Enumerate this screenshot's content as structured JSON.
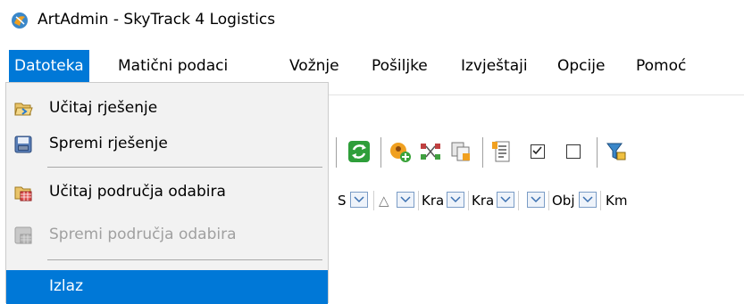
{
  "window": {
    "title": "ArtAdmin - SkyTrack 4 Logistics",
    "app_icon": "artadmin-icon"
  },
  "menubar": {
    "items": [
      {
        "label": "Datoteka",
        "open": true
      },
      {
        "label": "Matični podaci"
      },
      {
        "label": "Vožnje"
      },
      {
        "label": "Pošiljke"
      },
      {
        "label": "Izvještaji"
      },
      {
        "label": "Opcije"
      },
      {
        "label": "Pomoć"
      }
    ]
  },
  "file_menu": {
    "items": [
      {
        "label": "Učitaj rješenje",
        "icon": "folder-open-icon",
        "enabled": true
      },
      {
        "label": "Spremi rješenje",
        "icon": "save-icon",
        "enabled": true
      },
      {
        "label": "Učitaj područja odabira",
        "icon": "folder-grid-icon",
        "enabled": true
      },
      {
        "label": "Spremi područja odabira",
        "icon": "save-grid-icon",
        "enabled": false
      },
      {
        "label": "Izlaz",
        "icon": "",
        "enabled": true,
        "highlighted": true
      }
    ]
  },
  "toolbar": {
    "buttons": [
      "refresh-icon",
      "add-icon",
      "route-icon",
      "copy-icon",
      "report-icon",
      "check-all-icon",
      "uncheck-all-icon",
      "filter-icon"
    ]
  },
  "grid_filter": {
    "columns": [
      {
        "label": "S"
      },
      {
        "label": "△"
      },
      {
        "label": "Kra"
      },
      {
        "label": "Kra"
      },
      {
        "label": ""
      },
      {
        "label": "Obj"
      },
      {
        "label": "Km"
      }
    ]
  },
  "colors": {
    "accent": "#0078d7",
    "menu_bg": "#f2f2f2",
    "disabled": "#a0a0a0"
  }
}
